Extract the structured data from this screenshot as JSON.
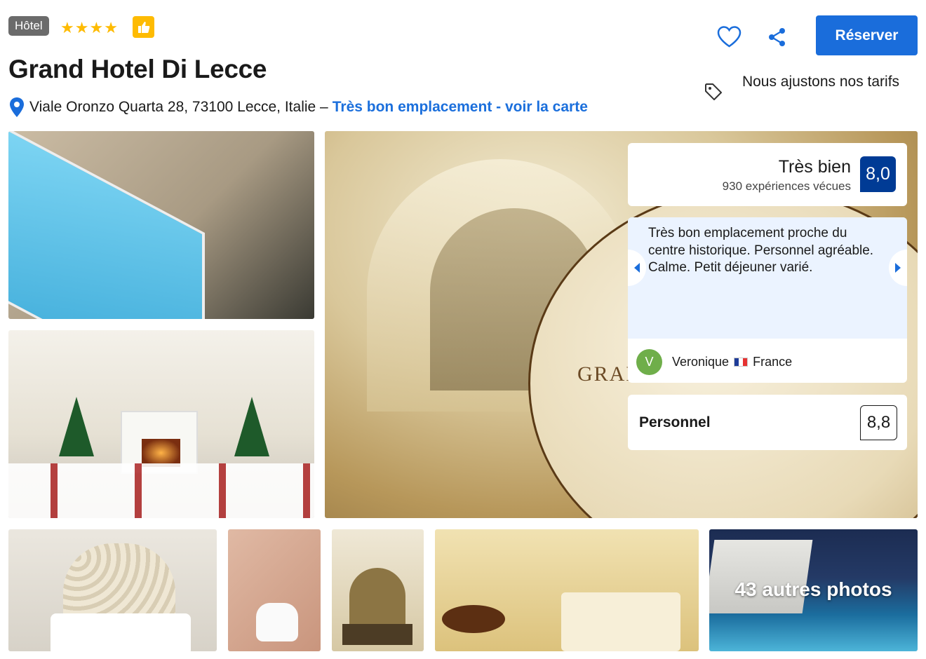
{
  "header": {
    "property_type": "Hôtel",
    "stars": 4,
    "title": "Grand Hotel Di Lecce",
    "address": "Viale Oronzo Quarta 28, 73100 Lecce, Italie –",
    "map_link": "Très bon emplacement - voir la carte"
  },
  "actions": {
    "reserve_label": "Réserver",
    "price_match_text": "Nous ajustons nos tarifs"
  },
  "review_panel": {
    "score_label": "Très bien",
    "review_count": "930 expériences vécues",
    "score": "8,0",
    "review_text": "Très bon emplacement proche du centre historique. Personnel agréable. Calme. Petit déjeuner varié.",
    "reviewer_initial": "V",
    "reviewer_name": "Veronique",
    "reviewer_country": "France",
    "subscore_label": "Personnel",
    "subscore": "8,8"
  },
  "gallery": {
    "main_photo_text": "GRAND HOTEL",
    "more_photos_label": "43 autres photos"
  },
  "colors": {
    "brand_blue": "#1a6ddb",
    "score_blue": "#003b95",
    "star_yellow": "#febb02"
  }
}
